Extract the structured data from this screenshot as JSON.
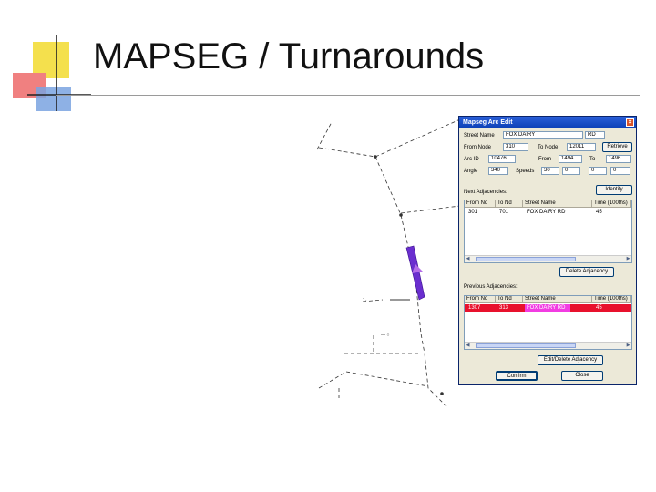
{
  "slide": {
    "title": "MAPSEG / Turnarounds"
  },
  "colors": {
    "accent_yellow": "#f4e04d",
    "accent_red": "#f08080",
    "accent_blue": "#7aa3e0",
    "highlight_row": "#e8112d",
    "selected_segment": "#6a2ecf"
  },
  "dialog": {
    "title": "Mapseg Arc Edit",
    "close_icon": "close-icon",
    "street_name_label": "Street Name",
    "street_name_value": "FOX DAIRY",
    "street_suffix_value": "RD",
    "from_node_label": "From Node",
    "from_node_value": "310",
    "to_node_label": "To Node",
    "to_node_value": "12011",
    "retrieve_label": "Retrieve",
    "arc_id_label": "Arc ID",
    "arc_id_value": "10476",
    "from_label": "From",
    "from_value": "1494",
    "to_label": "To",
    "to_value": "1496",
    "angle_label": "Angle",
    "angle_value": "340",
    "speeds_label": "Speeds",
    "speed_values": [
      "30",
      "0",
      "0",
      "0"
    ],
    "identify_label": "Identify",
    "next_adj_label": "Next Adjacencies:",
    "columns": [
      "From Nd",
      "To Nd",
      "Street Name",
      "Time (100ths)"
    ],
    "next_rows": [
      {
        "from": "301",
        "to": "701",
        "street": "FOX DAIRY RD",
        "time": "45"
      }
    ],
    "delete_adj_label": "Delete Adjacency",
    "prev_adj_label": "Previous Adjacencies:",
    "prev_rows": [
      {
        "from": "1307",
        "to": "313",
        "street": "FOX DAIRY RD",
        "time": "45"
      }
    ],
    "edit_delete_label": "Edit/Delete Adjacency",
    "confirm_label": "Confirm",
    "close_label": "Close"
  }
}
